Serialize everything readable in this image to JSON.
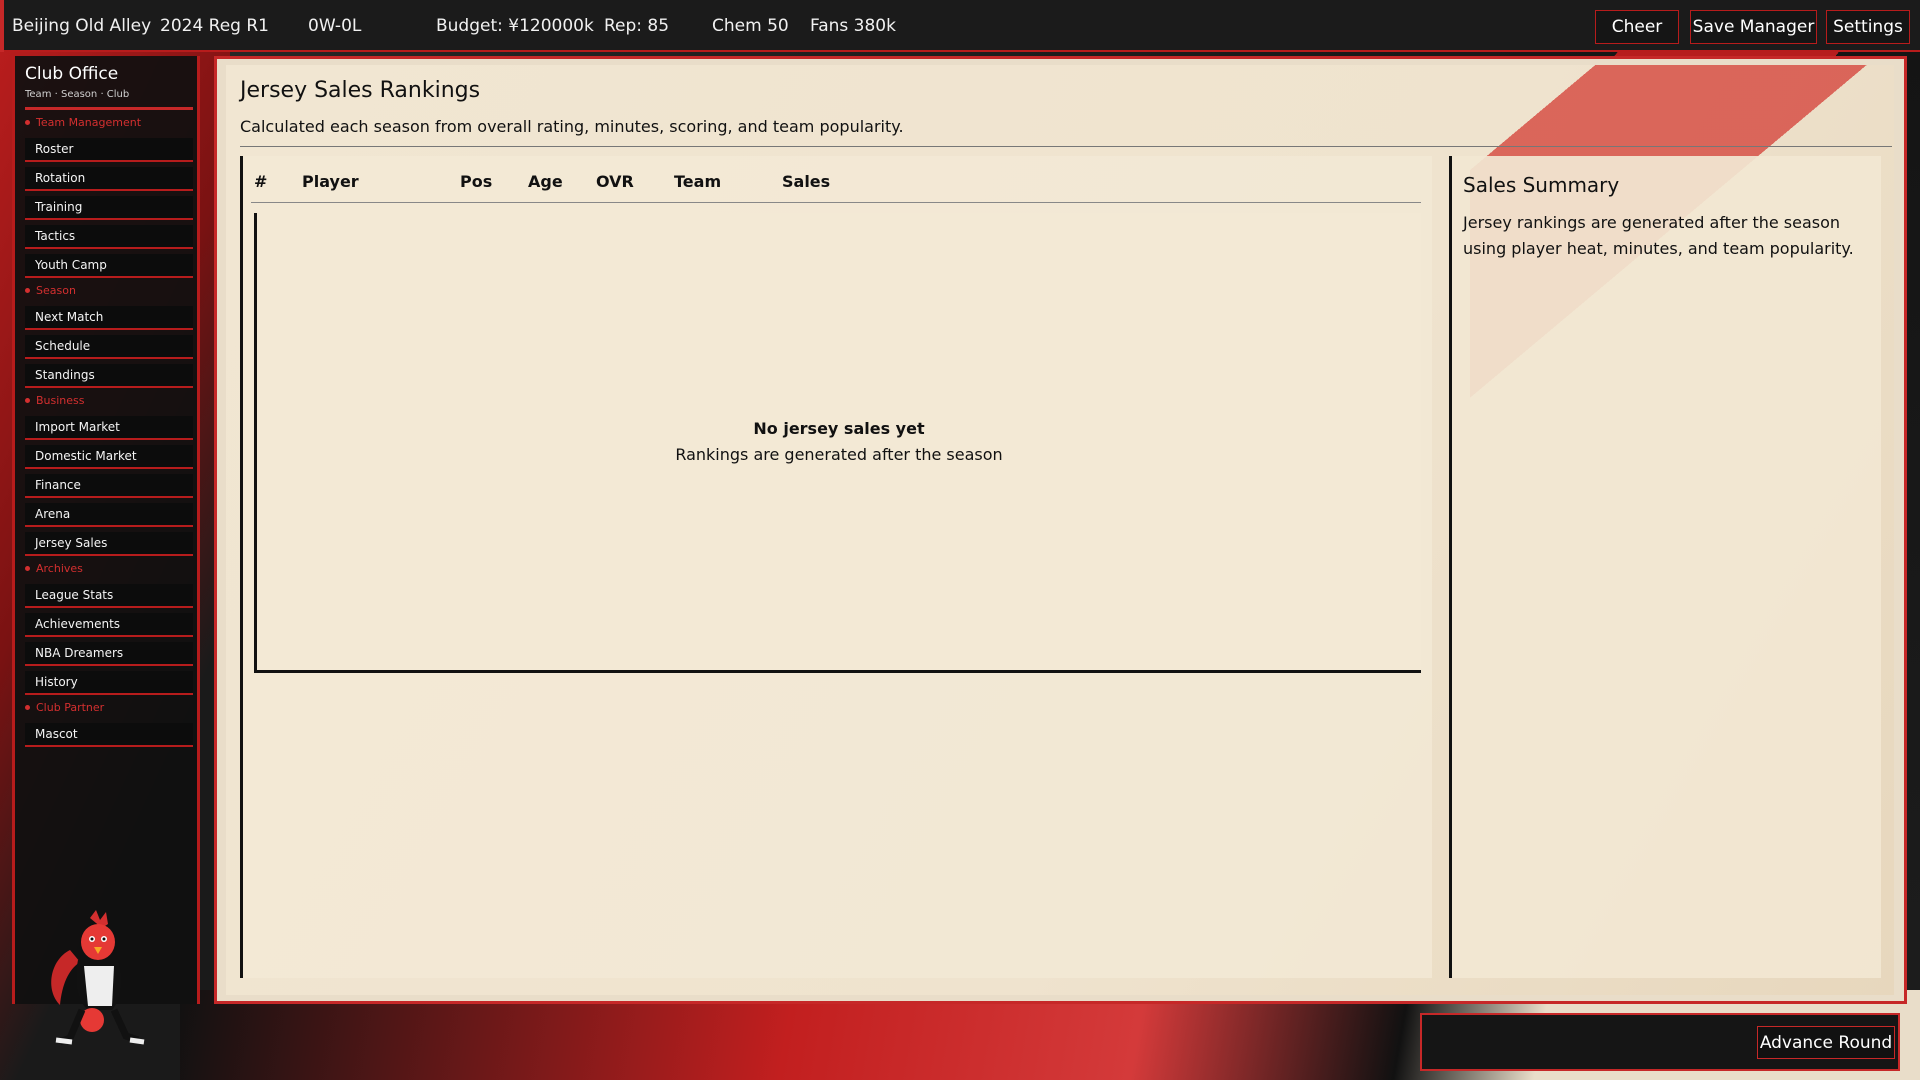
{
  "topbar": {
    "team": "Beijing Old Alley",
    "season": "2024 Reg R1",
    "record": "0W-0L",
    "budget": "Budget: ¥120000k",
    "rep": "Rep: 85",
    "chem": "Chem 50",
    "fans": "Fans 380k",
    "buttons": {
      "cheer": "Cheer",
      "save_manager": "Save Manager",
      "settings": "Settings"
    }
  },
  "sidebar": {
    "title": "Club Office",
    "subtitle": "Team · Season · Club",
    "categories": {
      "team_management": "Team Management",
      "season": "Season",
      "business": "Business",
      "archives": "Archives",
      "club_partner": "Club Partner"
    },
    "items": {
      "roster": "Roster",
      "rotation": "Rotation",
      "training": "Training",
      "tactics": "Tactics",
      "youth_camp": "Youth Camp",
      "next_match": "Next Match",
      "schedule": "Schedule",
      "standings": "Standings",
      "import_market": "Import Market",
      "domestic_market": "Domestic Market",
      "finance": "Finance",
      "arena": "Arena",
      "jersey_sales": "Jersey Sales",
      "league_stats": "League Stats",
      "achievements": "Achievements",
      "nba_dreamers": "NBA Dreamers",
      "history": "History",
      "mascot": "Mascot"
    }
  },
  "main": {
    "title": "Jersey Sales Rankings",
    "description": "Calculated each season from overall rating, minutes, scoring, and team popularity.",
    "table": {
      "columns": {
        "rank": "#",
        "player": "Player",
        "pos": "Pos",
        "age": "Age",
        "ovr": "OVR",
        "team": "Team",
        "sales": "Sales"
      },
      "rows": [],
      "empty_title": "No jersey sales yet",
      "empty_subtitle": "Rankings are generated after the season"
    },
    "summary": {
      "title": "Sales Summary",
      "text": "Jersey rankings are generated after the season using player heat, minutes, and team popularity."
    }
  },
  "footer": {
    "advance_button": "Advance Round"
  },
  "colors": {
    "accent": "#c62828",
    "panel": "#efe3ce",
    "dark": "#151515"
  }
}
